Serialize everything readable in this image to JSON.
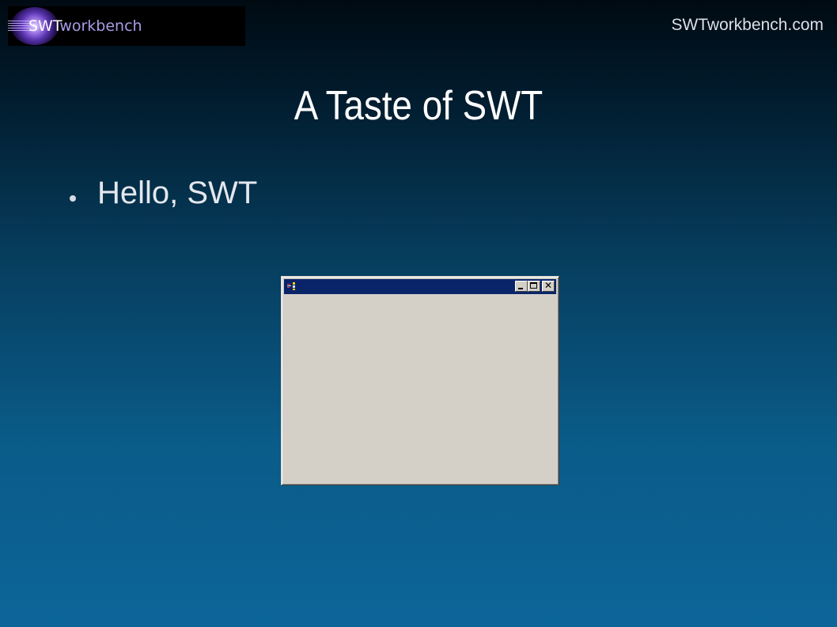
{
  "logo": {
    "swt": "SWT",
    "workbench": "workbench"
  },
  "header": {
    "site_url": "SWTworkbench.com"
  },
  "slide": {
    "title": "A Taste of SWT",
    "bullets": [
      {
        "text": "Hello, SWT"
      }
    ]
  },
  "shell_window": {
    "title": "",
    "icons": {
      "system": "swt-app-icon",
      "minimize": "minimize-icon",
      "maximize": "maximize-icon",
      "close": "close-icon"
    }
  },
  "colors": {
    "title_bar": "#0a246a",
    "window_face": "#d4d0c8",
    "slide_top": "#000a12",
    "slide_bottom": "#0c6599",
    "logo_accent": "#a99be6"
  }
}
